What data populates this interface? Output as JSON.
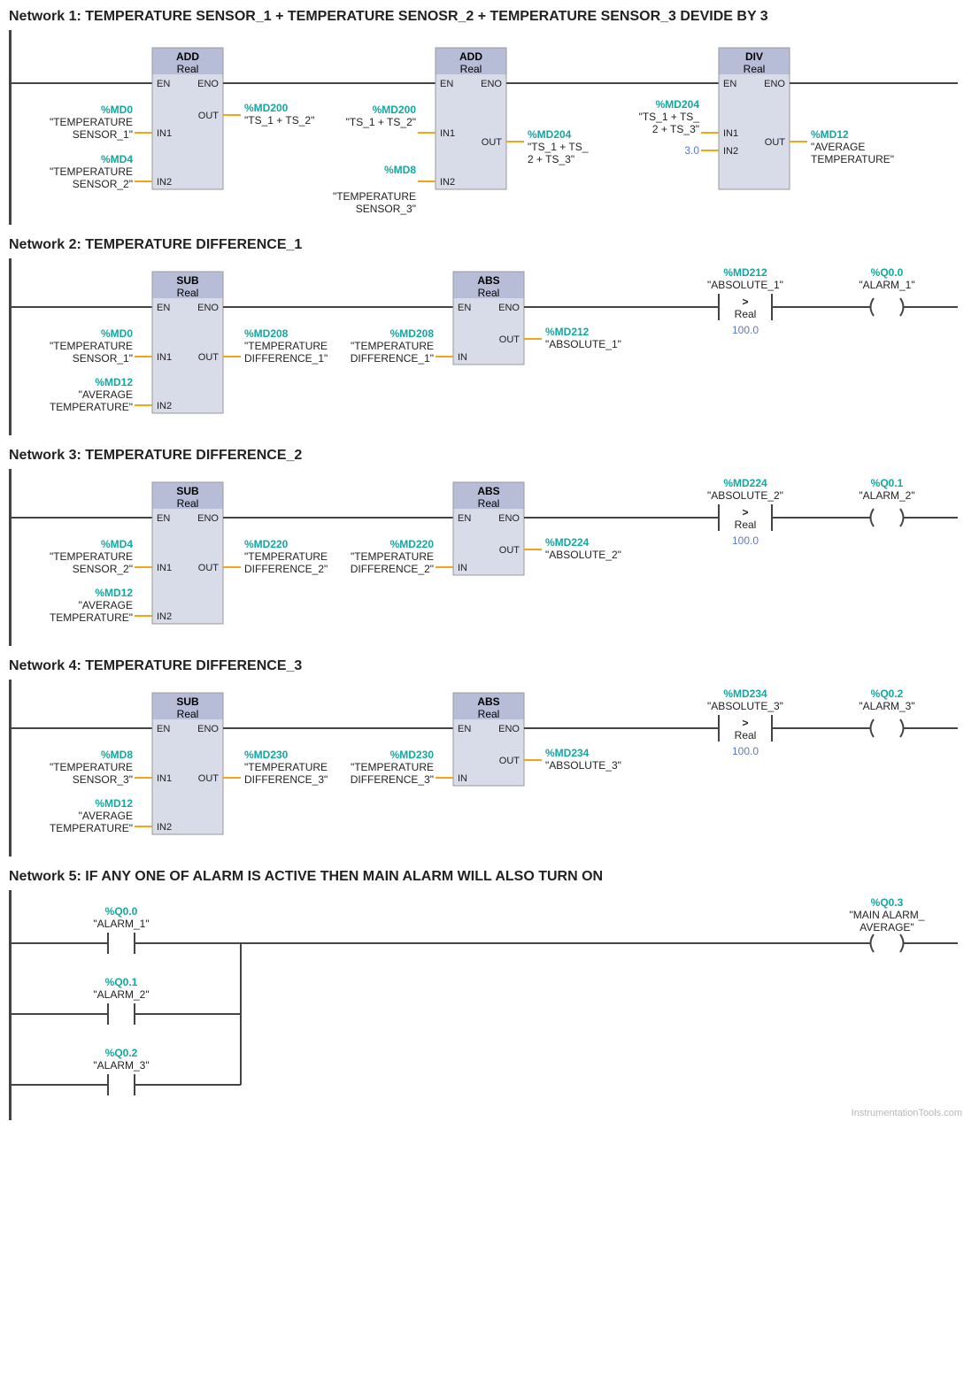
{
  "networks": [
    {
      "title": "Network 1: TEMPERATURE SENSOR_1 + TEMPERATURE SENOSR_2 + TEMPERATURE SENSOR_3 DEVIDE BY 3",
      "blocks": [
        {
          "op": "ADD",
          "type": "Real",
          "in1": {
            "addr": "%MD0",
            "name": "\"TEMPERATURE SENSOR_1\""
          },
          "in2": {
            "addr": "%MD4",
            "name": "\"TEMPERATURE SENSOR_2\""
          },
          "out": {
            "addr": "%MD200",
            "name": "\"TS_1 + TS_2\""
          }
        },
        {
          "op": "ADD",
          "type": "Real",
          "in1": {
            "addr": "%MD200",
            "name": "\"TS_1 + TS_2\""
          },
          "in2": {
            "addr": "%MD8",
            "name": "\"TEMPERATURE SENSOR_3\""
          },
          "out": {
            "addr": "%MD204",
            "name": "\"TS_1 + TS_2 + TS_3\""
          }
        },
        {
          "op": "DIV",
          "type": "Real",
          "in1": {
            "addr": "%MD204",
            "name": "\"TS_1 + TS_2 + TS_3\""
          },
          "in2_const": "3.0",
          "out": {
            "addr": "%MD12",
            "name": "\"AVERAGE TEMPERATURE\""
          }
        }
      ]
    },
    {
      "title": "Network 2: TEMPERATURE DIFFERENCE_1",
      "sub": {
        "op": "SUB",
        "type": "Real",
        "in1": {
          "addr": "%MD0",
          "name": "\"TEMPERATURE SENSOR_1\""
        },
        "in2": {
          "addr": "%MD12",
          "name": "\"AVERAGE TEMPERATURE\""
        },
        "out": {
          "addr": "%MD208",
          "name": "\"TEMPERATURE DIFFERENCE_1\""
        }
      },
      "abs": {
        "op": "ABS",
        "type": "Real",
        "in": {
          "addr": "%MD208",
          "name": "\"TEMPERATURE DIFFERENCE_1\""
        },
        "out": {
          "addr": "%MD212",
          "name": "\"ABSOLUTE_1\""
        }
      },
      "cmp": {
        "addr": "%MD212",
        "name": "\"ABSOLUTE_1\"",
        "op": ">",
        "type": "Real",
        "const": "100.0"
      },
      "coil": {
        "addr": "%Q0.0",
        "name": "\"ALARM_1\""
      }
    },
    {
      "title": "Network 3: TEMPERATURE DIFFERENCE_2",
      "sub": {
        "op": "SUB",
        "type": "Real",
        "in1": {
          "addr": "%MD4",
          "name": "\"TEMPERATURE SENSOR_2\""
        },
        "in2": {
          "addr": "%MD12",
          "name": "\"AVERAGE TEMPERATURE\""
        },
        "out": {
          "addr": "%MD220",
          "name": "\"TEMPERATURE DIFFERENCE_2\""
        }
      },
      "abs": {
        "op": "ABS",
        "type": "Real",
        "in": {
          "addr": "%MD220",
          "name": "\"TEMPERATURE DIFFERENCE_2\""
        },
        "out": {
          "addr": "%MD224",
          "name": "\"ABSOLUTE_2\""
        }
      },
      "cmp": {
        "addr": "%MD224",
        "name": "\"ABSOLUTE_2\"",
        "op": ">",
        "type": "Real",
        "const": "100.0"
      },
      "coil": {
        "addr": "%Q0.1",
        "name": "\"ALARM_2\""
      }
    },
    {
      "title": "Network 4: TEMPERATURE DIFFERENCE_3",
      "sub": {
        "op": "SUB",
        "type": "Real",
        "in1": {
          "addr": "%MD8",
          "name": "\"TEMPERATURE SENSOR_3\""
        },
        "in2": {
          "addr": "%MD12",
          "name": "\"AVERAGE TEMPERATURE\""
        },
        "out": {
          "addr": "%MD230",
          "name": "\"TEMPERATURE DIFFERENCE_3\""
        }
      },
      "abs": {
        "op": "ABS",
        "type": "Real",
        "in": {
          "addr": "%MD230",
          "name": "\"TEMPERATURE DIFFERENCE_3\""
        },
        "out": {
          "addr": "%MD234",
          "name": "\"ABSOLUTE_3\""
        }
      },
      "cmp": {
        "addr": "%MD234",
        "name": "\"ABSOLUTE_3\"",
        "op": ">",
        "type": "Real",
        "const": "100.0"
      },
      "coil": {
        "addr": "%Q0.2",
        "name": "\"ALARM_3\""
      }
    },
    {
      "title": "Network 5: IF ANY ONE OF ALARM IS ACTIVE THEN MAIN ALARM WILL ALSO TURN ON",
      "contacts": [
        {
          "addr": "%Q0.0",
          "name": "\"ALARM_1\""
        },
        {
          "addr": "%Q0.1",
          "name": "\"ALARM_2\""
        },
        {
          "addr": "%Q0.2",
          "name": "\"ALARM_3\""
        }
      ],
      "coil": {
        "addr": "%Q0.3",
        "name": "\"MAIN ALARM_AVERAGE\""
      }
    }
  ],
  "watermark": "InstrumentationTools.com",
  "labels": {
    "EN": "EN",
    "ENO": "ENO",
    "IN1": "IN1",
    "IN2": "IN2",
    "IN": "IN",
    "OUT": "OUT"
  }
}
